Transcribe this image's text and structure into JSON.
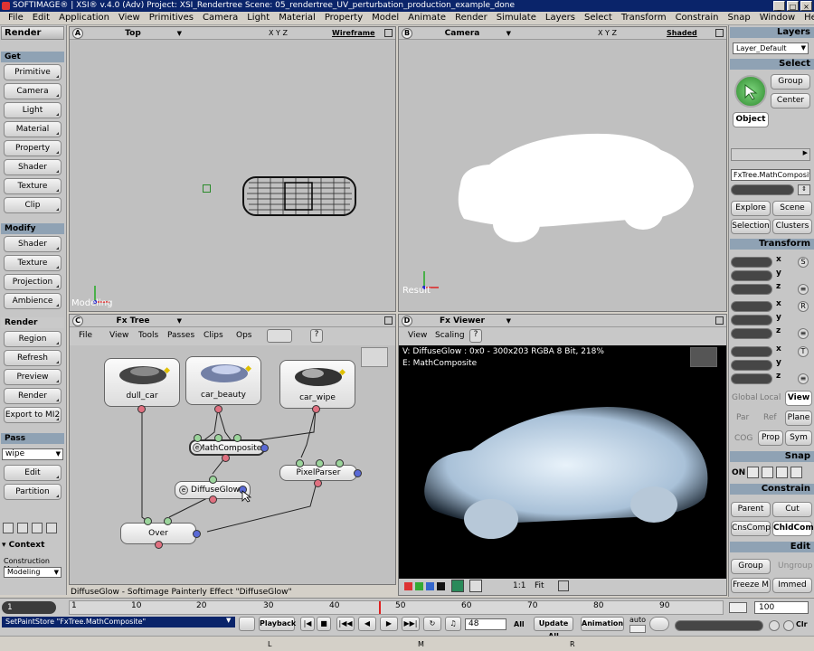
{
  "title": "SOFTIMAGE® | XSI® v.4.0 (Adv) Project: XSI_Rendertree    Scene: 05_rendertree_UV_perturbation_production_example_done",
  "menus": [
    "File",
    "Edit",
    "Application",
    "View",
    "Primitives",
    "Camera",
    "Light",
    "Material",
    "Property",
    "Model",
    "Animate",
    "Render",
    "Simulate",
    "Layers",
    "Select",
    "Transform",
    "Constrain",
    "Snap",
    "Window",
    "Help"
  ],
  "left": {
    "mode": "Render",
    "get_header": "Get",
    "get_items": [
      "Primitive",
      "Camera",
      "Light",
      "Material",
      "Property",
      "Shader",
      "Texture",
      "Clip"
    ],
    "modify_header": "Modify",
    "modify_items": [
      "Shader",
      "Texture",
      "Projection",
      "Ambience"
    ],
    "render_header": "Render",
    "render_items": [
      "Region",
      "Refresh",
      "Preview",
      "Render",
      "Export to MI2"
    ],
    "pass_header": "Pass",
    "pass_value": "wipe",
    "pass_items": [
      "Edit",
      "Partition"
    ],
    "context": "Context",
    "construction_label": "Construction Mode",
    "construction_value": "Modeling"
  },
  "vpA": {
    "letter": "A",
    "name": "Top",
    "xyz": "X Y Z",
    "mode": "Wireframe",
    "footer": "Modeling"
  },
  "vpB": {
    "letter": "B",
    "name": "Camera",
    "xyz": "X Y Z",
    "mode": "Shaded",
    "footer": "Result"
  },
  "vpC": {
    "letter": "C",
    "name": "Fx Tree",
    "menus": [
      "File",
      "View",
      "Tools",
      "Passes",
      "Clips",
      "Ops"
    ]
  },
  "vpD": {
    "letter": "D",
    "name": "Fx Viewer",
    "menus": [
      "View",
      "Scaling"
    ],
    "info1": "V: DiffuseGlow : 0x0 - 300x203 RGBA 8 Bit, 218%",
    "info2": "E: MathComposite",
    "zoom": "1:1",
    "fit": "Fit"
  },
  "nodes": {
    "dull": "dull_car",
    "beauty": "car_beauty",
    "wipe": "car_wipe",
    "math": "MathComposite",
    "pixel": "PixelParser",
    "glow": "DiffuseGlow",
    "over": "Over",
    "e": "e"
  },
  "right": {
    "layers": "Layers",
    "layer_value": "Layer_Default",
    "select": "Select",
    "group": "Group",
    "center": "Center",
    "object": "Object",
    "field": "FxTree.MathComposit",
    "explore": "Explore",
    "scene": "Scene",
    "selection": "Selection",
    "clusters": "Clusters",
    "transform": "Transform",
    "x": "x",
    "y": "y",
    "z": "z",
    "s": "S",
    "r": "R",
    "t": "T",
    "global": "Global",
    "local": "Local",
    "view": "View",
    "par": "Par",
    "ref": "Ref",
    "plane": "Plane",
    "cog": "COG",
    "prop": "Prop",
    "sym": "Sym",
    "snap": "Snap",
    "on": "ON",
    "constrain": "Constrain",
    "parent": "Parent",
    "cut": "Cut",
    "cnscomp": "CnsComp",
    "chldcomp": "ChldComp",
    "edit": "Edit",
    "egroup": "Group",
    "ungroup": "Ungroup",
    "freeze": "Freeze M",
    "immed": "Immed"
  },
  "status_msg": "DiffuseGlow - Softimage Painterly Effect \"DiffuseGlow\"",
  "timeline": {
    "start": "1",
    "end": "100",
    "ticks": [
      "1",
      "10",
      "20",
      "30",
      "40",
      "50",
      "60",
      "70",
      "80",
      "90"
    ]
  },
  "bottom": {
    "script": "SetPaintStore \"FxTree.MathComposite\"",
    "playback": "Playback",
    "frame": "48",
    "all": "All",
    "update": "Update All",
    "animation": "Animation",
    "auto": "auto",
    "clr": "Clr",
    "mouse": [
      "L",
      "M",
      "R"
    ]
  },
  "colors": {
    "accent": "#8fa2b4",
    "viewport": "#c0c0c0",
    "panel": "#c6c6c6"
  }
}
